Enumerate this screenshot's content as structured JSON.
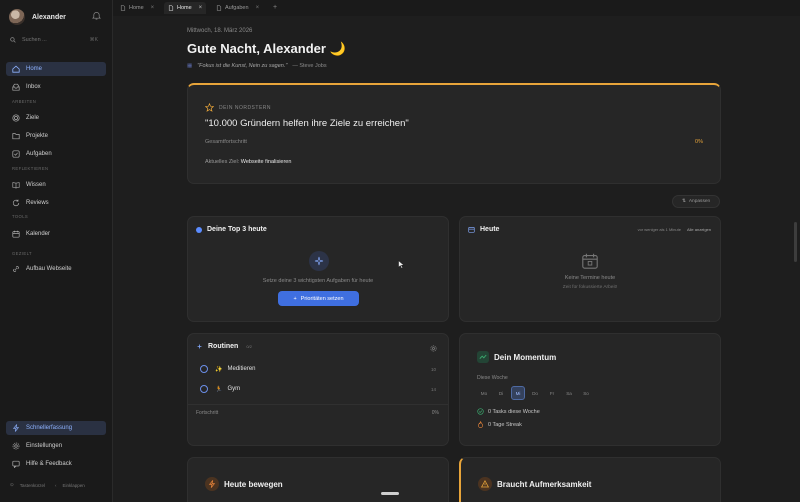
{
  "sidebar": {
    "user_name": "Alexander",
    "search_placeholder": "Suchen ...",
    "search_shortcut": "⌘K",
    "items": {
      "home": "Home",
      "inbox": "Inbox",
      "ziele": "Ziele",
      "projekte": "Projekte",
      "aufgaben": "Aufgaben",
      "wissen": "Wissen",
      "reviews": "Reviews",
      "kalender": "Kalender",
      "aufbau": "Aufbau Webseite",
      "schnellerfassung": "Schnellerfassung",
      "einstellungen": "Einstellungen",
      "hilfe": "Hilfe & Feedback"
    },
    "sections": {
      "arbeiten": "ARBEITEN",
      "reflektieren": "REFLEKTIEREN",
      "tools": "TOOLS",
      "gezielt": "GEZIELT"
    },
    "footer": {
      "shortcuts": "Tastenkürzel",
      "collapse": "Einklappen"
    }
  },
  "tabs": [
    {
      "label": "Home",
      "active": false
    },
    {
      "label": "Home",
      "active": true
    },
    {
      "label": "Aufgaben",
      "active": false
    }
  ],
  "main": {
    "date": "Mittwoch, 18. März 2026",
    "greeting": "Gute Nacht, Alexander 🌙",
    "quote": "\"Fokus ist die Kunst, Nein zu sagen.\"",
    "quote_author": "— Steve Jobs",
    "north_star": {
      "label": "DEIN NORDSTERN",
      "goal": "\"10.000 Gründern helfen ihre Ziele zu erreichen\"",
      "progress_label": "Gesamtfortschritt",
      "progress_value": "0%",
      "current_label": "Aktuelles Ziel:",
      "current_goal": "Webseite finalisieren"
    },
    "adjust_label": "Anpassen",
    "top3": {
      "title": "Deine Top 3 heute",
      "empty": "Setze deine 3 wichtigsten Aufgaben für heute",
      "button": "Prioritäten setzen"
    },
    "today": {
      "title": "Heute",
      "meta": "vor weniger als 1 Minute",
      "link": "Alle anzeigen",
      "empty": "Keine Termine heute",
      "empty_sub": "Zeit für fokussierte Arbeit!"
    },
    "routines": {
      "title": "Routinen",
      "badge": "0/2",
      "items": [
        {
          "emoji": "✨",
          "label": "Meditieren",
          "num": "10"
        },
        {
          "emoji": "🏃",
          "label": "Gym",
          "num": "14"
        }
      ],
      "progress_label": "Fortschritt",
      "progress_value": "0%"
    },
    "momentum": {
      "title": "Dein Momentum",
      "week_label": "Diese Woche",
      "days": [
        "Mo",
        "Di",
        "Mi",
        "Do",
        "Fr",
        "Sa",
        "So"
      ],
      "today_index": 2,
      "tasks": "0 Tasks diese Woche",
      "streak": "0 Tage Streak"
    },
    "moving": {
      "title": "Heute bewegen"
    },
    "attention": {
      "title": "Braucht Aufmerksamkeit"
    }
  },
  "colors": {
    "accent": "#3f6fe0",
    "warning": "#e7a43a",
    "success": "#3aa76d"
  }
}
